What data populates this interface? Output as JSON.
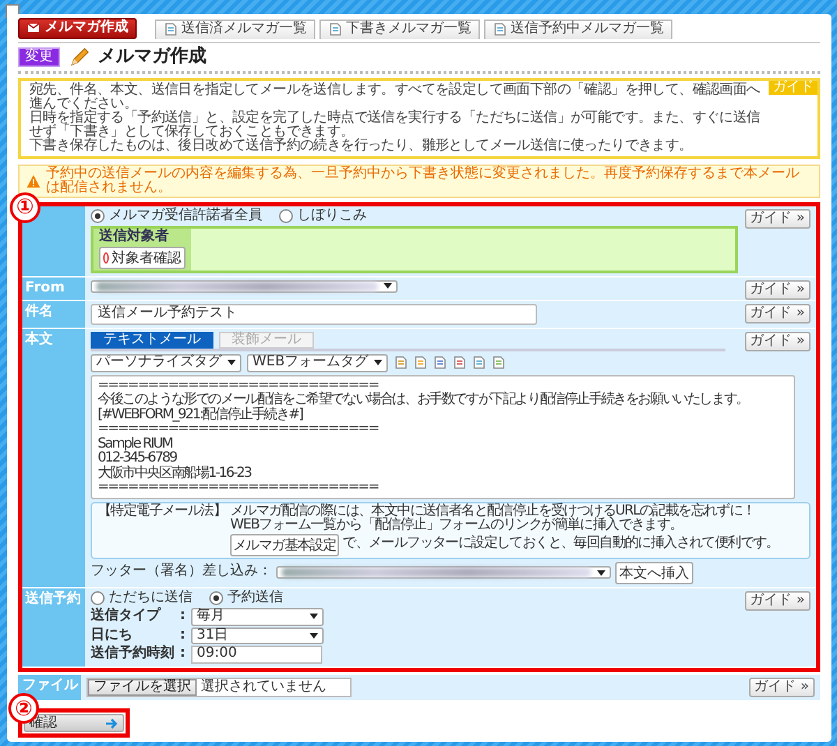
{
  "nav": [
    {
      "label": "メルマガ作成",
      "selected": true
    },
    {
      "label": "送信済メルマガ一覧",
      "selected": false
    },
    {
      "label": "下書きメルマガ一覧",
      "selected": false
    },
    {
      "label": "送信予約中メルマガ一覧",
      "selected": false
    }
  ],
  "title": {
    "badge": "変更",
    "text": "メルマガ作成"
  },
  "info": {
    "tag": "ガイド",
    "lines": [
      "宛先、件名、本文、送信日を指定してメールを送信します。すべてを設定して画面下部の「確認」を押して、確認画面へ進んでください。",
      "日時を指定する「予約送信」と、設定を完了した時点で送信を実行する「ただちに送信」が可能です。また、すぐに送信せず「下書き」として保存しておくこともできます。",
      "下書き保存したものは、後日改めて送信予約の続きを行ったり、雛形としてメール送信に使ったりできます。"
    ]
  },
  "warning": "予約中の送信メールの内容を編集する為、一旦予約中から下書き状態に変更されました。再度予約保存するまで本メールは配信されません。",
  "annotations": [
    "①",
    "②"
  ],
  "form": {
    "rows": [
      {
        "kind": "recipients",
        "guide": "ガイド »",
        "options": [
          {
            "label": "メルマガ受信許諾者全員",
            "selected": true
          },
          {
            "label": "しぼりこみ",
            "selected": false
          }
        ],
        "target_title": "送信対象者",
        "target_button": "対象者確認"
      },
      {
        "kind": "from",
        "label": "From",
        "guide": "ガイド »"
      },
      {
        "kind": "subject",
        "label": "件名",
        "guide": "ガイド »",
        "value": "送信メール予約テスト"
      },
      {
        "kind": "body",
        "label": "本文",
        "guide": "ガイド »",
        "tabs": [
          {
            "label": "テキストメール",
            "selected": true
          },
          {
            "label": "装飾メール",
            "selected": false
          }
        ],
        "tag_selects": [
          "パーソナライズタグ",
          "WEBフォームタグ"
        ],
        "text_lines": [
          "============================",
          "今後このような形でのメール配信をご希望でない場合は、お手数ですが下記より配信停止手続きをお願いいたします。",
          "[#WEBFORM_921:配信停止手続き#]",
          "============================",
          "Sample RIUM",
          "012-345-6789",
          "大阪市中央区南船場1-16-23",
          "============================"
        ],
        "notice": {
          "lead": "【特定電子メール法】",
          "lines": [
            "メルマガ配信の際には、本文中に送信者名と配信停止を受けつけるURLの記載を忘れずに！",
            "WEBフォーム一覧から「配信停止」フォームのリンクが簡単に挿入できます。"
          ],
          "button": "メルマガ基本設定",
          "tail": "で、メールフッターに設定しておくと、毎回自動的に挿入されて便利です。"
        },
        "footer_label": "フッター（署名）差し込み：",
        "insert_button": "本文へ挿入"
      },
      {
        "kind": "schedule",
        "label": "送信予約",
        "guide": "ガイド »",
        "options": [
          {
            "label": "ただちに送信",
            "selected": false
          },
          {
            "label": "予約送信",
            "selected": true
          }
        ],
        "fields": [
          {
            "kind": "select",
            "label": "送信タイプ",
            "colon": ":",
            "value": "毎月"
          },
          {
            "kind": "select",
            "label": "日にち",
            "colon": ":",
            "value": "31日"
          },
          {
            "kind": "input",
            "label": "送信予約時刻",
            "colon": ":",
            "value": "09:00"
          }
        ]
      }
    ],
    "file_row": {
      "label": "ファイル",
      "guide": "ガイド »",
      "button": "ファイルを選択",
      "status": "選択されていません"
    }
  },
  "confirm_button": "確認"
}
